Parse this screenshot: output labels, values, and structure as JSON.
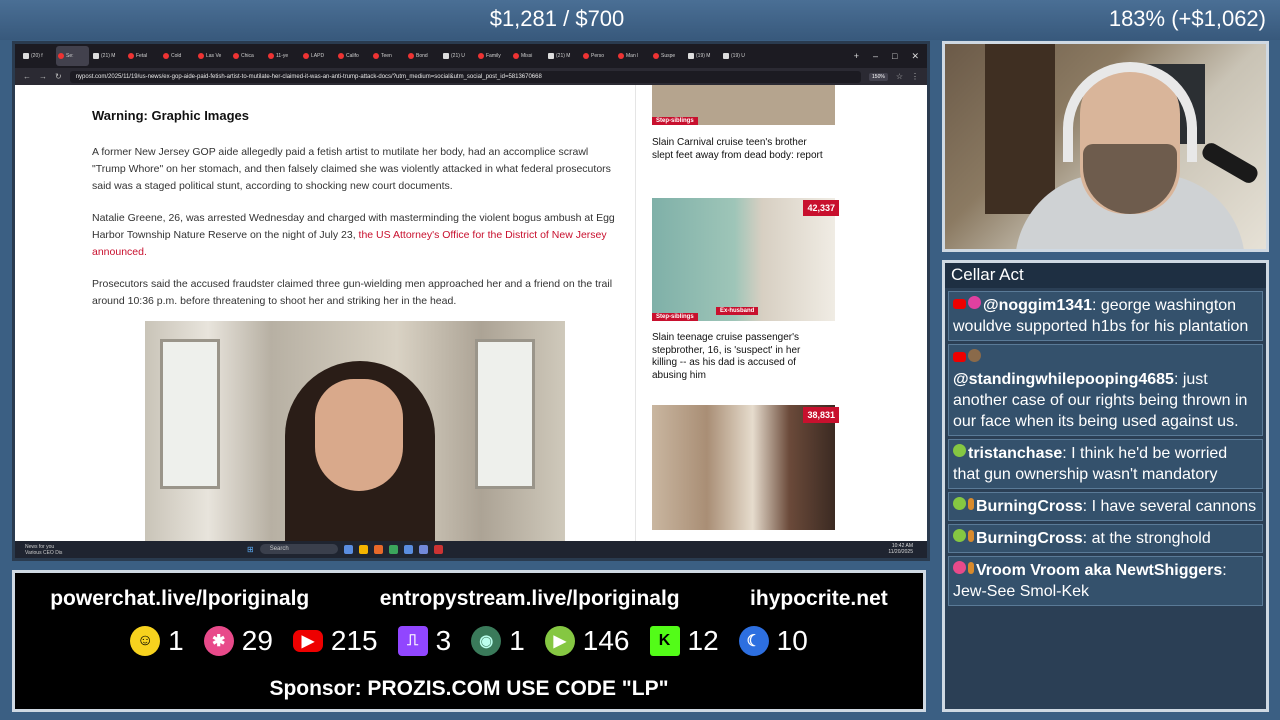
{
  "overlay": {
    "goal": "$1,281 / $700",
    "percent": "183% (+$1,062)"
  },
  "browser": {
    "tabs": [
      "(20) f",
      "Se:",
      "(21) M",
      "Fetal",
      "Cold",
      "Las Ve",
      "Chica",
      "11-ye",
      "LAPD",
      "Califo",
      "Teen",
      "Bond",
      "(21) U",
      "Family",
      "Missi",
      "(21) M",
      "Perso",
      "Man l",
      "Suspe",
      "(19) M",
      "(19) U"
    ],
    "url": "nypost.com/2025/11/19/us-news/ex-gop-aide-paid-fetish-artist-to-mutilate-her-claimed-it-was-an-anti-trump-attack-docs/?utm_medium=social&utm_social_post_id=5813670668",
    "zoom": "150%"
  },
  "article": {
    "heading": "Warning: Graphic Images",
    "p1": "A former New Jersey GOP aide allegedly paid a fetish artist to mutilate her body, had an accomplice scrawl \"Trump Whore\" on her stomach, and then falsely claimed she was violently attacked in what federal prosecutors said was a staged political stunt, according to shocking new court documents.",
    "p2_text": "Natalie Greene, 26, was arrested Wednesday and charged with masterminding the violent bogus ambush at Egg Harbor Township Nature Reserve on the night of July 23, ",
    "p2_link": "the US Attorney's Office for the District of New Jersey announced.",
    "p3": "Prosecutors said the accused fraudster claimed three gun-wielding men approached her and a friend on the trail around 10:36 p.m. before threatening to shoot her and striking her in the head."
  },
  "rail": {
    "tag1": "Step-siblings",
    "cap1": "Slain Carnival cruise teen's brother slept feet away from dead body: report",
    "count2": "42,337",
    "tag2a": "Step-siblings",
    "tag2b": "Ex-husband",
    "cap2": "Slain teenage cruise passenger's stepbrother, 16, is 'suspect' in her killing -- as his dad is accused of abusing him",
    "count3": "38,831"
  },
  "taskbar": {
    "news": "News for you",
    "news_sub": "Various CEO Dis",
    "search": "Search",
    "time": "10:42 AM",
    "date": "11/20/2025"
  },
  "chat": {
    "title": "Cellar Act",
    "messages": [
      {
        "user": "@noggim1341",
        "text": ": george washington wouldve supported h1bs for his plantation"
      },
      {
        "user": "@standingwhilepooping4685",
        "text": ": just another case of our rights being thrown in our face when its being used against us."
      },
      {
        "user": "tristanchase",
        "text": ": I think he'd be worried that gun ownership wasn't mandatory"
      },
      {
        "user": "BurningCross",
        "text": ": I have several cannons"
      },
      {
        "user": "BurningCross",
        "text": ": at the stronghold"
      },
      {
        "user": "Vroom Vroom aka NewtShiggers",
        "text": ": Jew-See Smol-Kek"
      }
    ]
  },
  "bottom": {
    "link1": "powerchat.live/lporiginalg",
    "link2": "entropystream.live/lporiginalg",
    "link3": "ihypocrite.net",
    "counts": [
      "1",
      "29",
      "215",
      "3",
      "1",
      "146",
      "12",
      "10"
    ],
    "sponsor": "Sponsor: PROZIS.COM USE CODE \"LP\""
  }
}
